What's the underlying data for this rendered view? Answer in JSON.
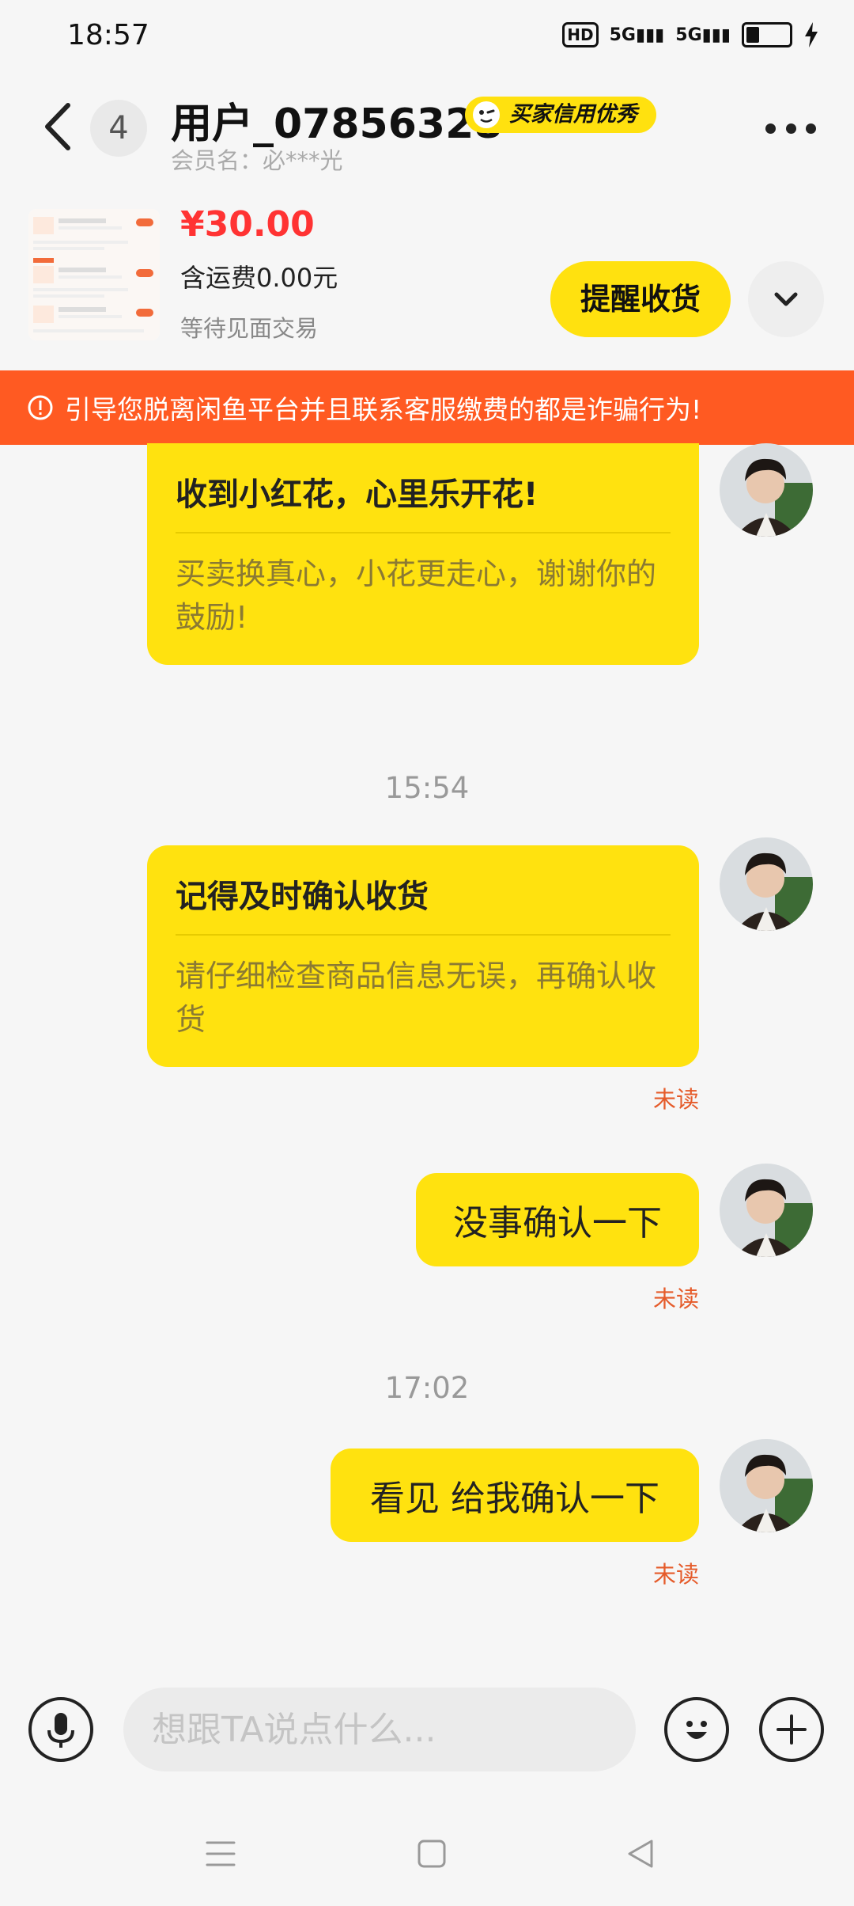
{
  "status_bar": {
    "time": "18:57",
    "network_1": "5G",
    "network_2": "5G",
    "hd": "HD"
  },
  "header": {
    "unread_count": "4",
    "user_name": "用户_07856328",
    "credit_badge": "买家信用优秀",
    "member_name": "会员名：必***光"
  },
  "product": {
    "price": "¥30.00",
    "shipping": "含运费0.00元",
    "status": "等待见面交易",
    "remind_button": "提醒收货"
  },
  "warning": {
    "text": "引导您脱离闲鱼平台并且联系客服缴费的都是诈骗行为!"
  },
  "messages": {
    "card1": {
      "title": "收到小红花，心里乐开花!",
      "desc": "买卖换真心，小花更走心，谢谢你的鼓励!"
    },
    "time1": "15:54",
    "card2": {
      "title": "记得及时确认收货",
      "desc": "请仔细检查商品信息无误，再确认收货",
      "status": "未读"
    },
    "msg3": {
      "text": "没事确认一下",
      "status": "未读"
    },
    "time2": "17:02",
    "msg4": {
      "text": "看见 给我确认一下",
      "status": "未读"
    }
  },
  "input": {
    "placeholder": "想跟TA说点什么..."
  },
  "colors": {
    "accent_yellow": "#ffe20f",
    "warning_orange": "#ff5a22",
    "price_red": "#ff3333",
    "unread_orange": "#e55b2a"
  },
  "icons": [
    "back-icon",
    "more-icon",
    "chevron-down-icon",
    "warning-icon",
    "microphone-icon",
    "emoji-icon",
    "plus-icon",
    "menu-icon",
    "home-icon",
    "back-nav-icon"
  ]
}
